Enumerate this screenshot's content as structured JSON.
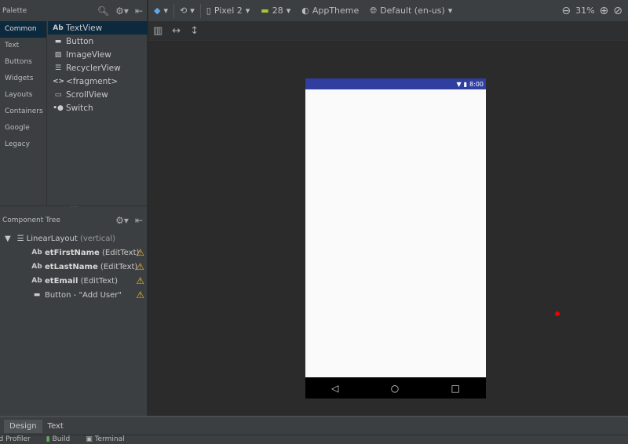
{
  "palette": {
    "title": "Palette",
    "categories": [
      "Common",
      "Text",
      "Buttons",
      "Widgets",
      "Layouts",
      "Containers",
      "Google",
      "Legacy"
    ],
    "items": [
      {
        "icon": "Ab",
        "label": "TextView"
      },
      {
        "icon": "▬",
        "label": "Button"
      },
      {
        "icon": "▨",
        "label": "ImageView"
      },
      {
        "icon": "☰",
        "label": "RecyclerView"
      },
      {
        "icon": "<>",
        "label": "<fragment>"
      },
      {
        "icon": "▭",
        "label": "ScrollView"
      },
      {
        "icon": "•●",
        "label": "Switch"
      }
    ]
  },
  "tree": {
    "title": "Component Tree",
    "root": {
      "name": "LinearLayout",
      "type": "(vertical)"
    },
    "children": [
      {
        "icon": "Ab",
        "name": "etFirstName",
        "type": "(EditText)"
      },
      {
        "icon": "Ab",
        "name": "etLastName",
        "type": "(EditText)"
      },
      {
        "icon": "Ab",
        "name": "etEmail",
        "type": "(EditText)"
      },
      {
        "icon": "▬",
        "name": "",
        "type": "Button - \"Add User\""
      }
    ]
  },
  "toolbar": {
    "device": "Pixel 2",
    "api": "28",
    "theme": "AppTheme",
    "locale": "Default (en-us)",
    "zoom": "31%"
  },
  "phone": {
    "time": "8:00"
  },
  "tabs": [
    "Design",
    "Text"
  ],
  "bottom": [
    "id Profiler",
    "Build",
    "Terminal"
  ]
}
